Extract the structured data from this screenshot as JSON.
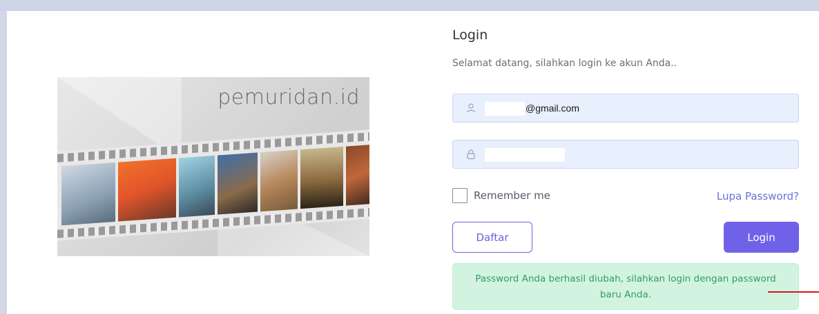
{
  "banner": {
    "brand": "pemuridan.id"
  },
  "login": {
    "title": "Login",
    "subtitle": "Selamat datang, silahkan login ke akun Anda..",
    "email_value": "@gmail.com",
    "remember_label": "Remember me",
    "remember_checked": false,
    "forgot_label": "Lupa Password?",
    "register_label": "Daftar",
    "login_label": "Login",
    "alert_message": "Password Anda berhasil diubah, silahkan login dengan password baru Anda."
  },
  "icons": {
    "email": "user-icon",
    "password": "lock-icon"
  },
  "colors": {
    "accent": "#6f62e8",
    "field_bg": "#e8effd",
    "success_bg": "#d3f3e1",
    "success_text": "#2f9e5f",
    "link": "#6b70d8"
  }
}
